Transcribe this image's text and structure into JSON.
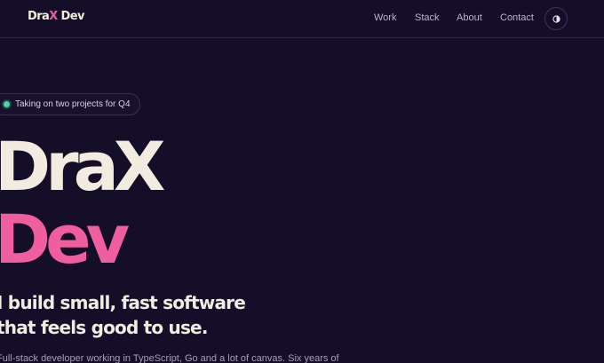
{
  "header": {
    "logo": {
      "part1": "Dra",
      "part2": "X",
      "part3": " Dev"
    },
    "nav": [
      {
        "label": "Work"
      },
      {
        "label": "Stack"
      },
      {
        "label": "About"
      },
      {
        "label": "Contact"
      }
    ],
    "theme_toggle_icon": "half-circle-contrast-icon"
  },
  "status": {
    "text": "Taking on two projects for Q4",
    "dot_color": "#4fd4a6"
  },
  "hero": {
    "line1": "DraX",
    "line2": "Dev",
    "accent_color": "#ef5f9f"
  },
  "tagline": {
    "line1": "I build small, fast software",
    "line2": "that feels good to use."
  },
  "intro": "Full-stack developer working in TypeScript, Go and a lot of canvas. Six years of"
}
